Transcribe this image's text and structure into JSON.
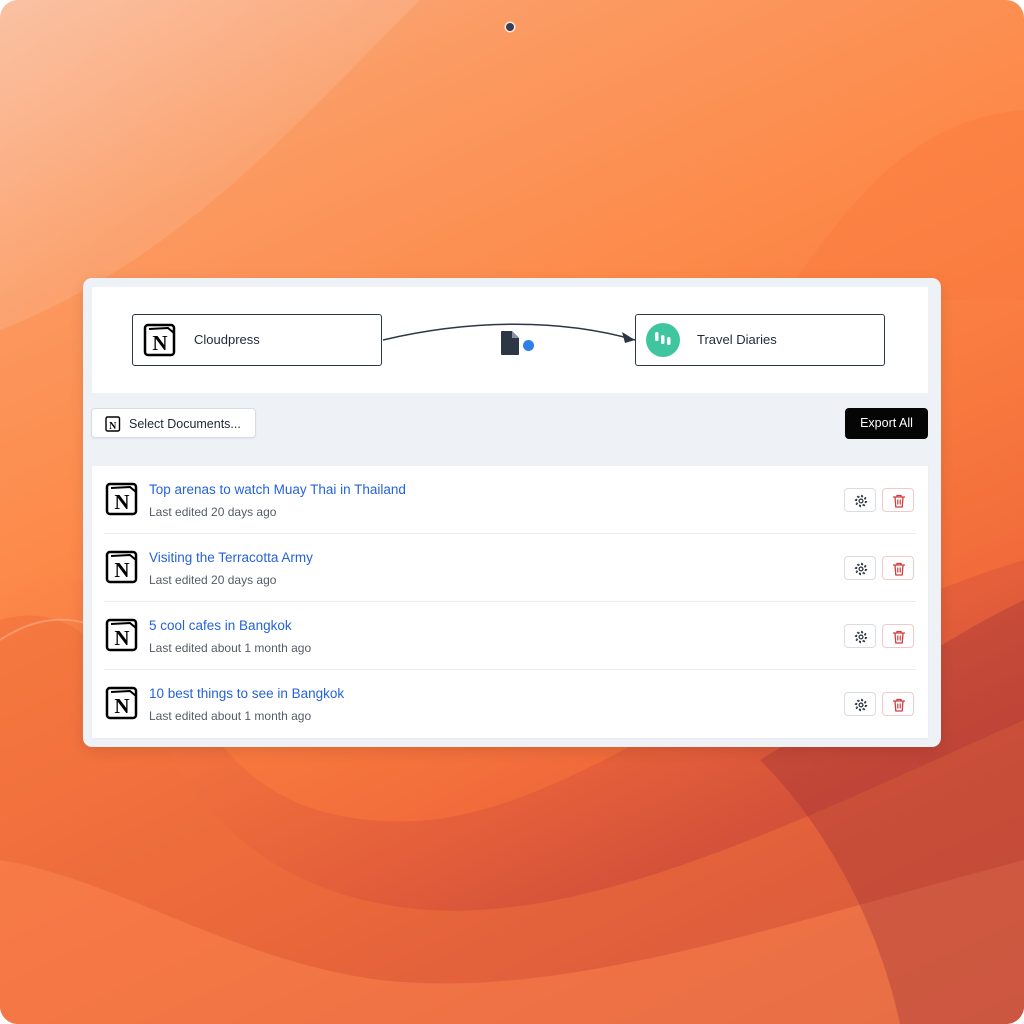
{
  "flow": {
    "source": {
      "label": "Cloudpress",
      "icon": "notion-icon"
    },
    "destination": {
      "label": "Travel Diaries",
      "icon": "ghost-icon",
      "color": "#3fc6a0"
    },
    "connector_icon": "document-icon",
    "status_color": "#2f7fe8"
  },
  "toolbar": {
    "select_label": "Select Documents...",
    "export_label": "Export All"
  },
  "documents": [
    {
      "title": "Top arenas to watch Muay Thai in Thailand",
      "meta": "Last edited 20 days ago"
    },
    {
      "title": "Visiting the Terracotta Army",
      "meta": "Last edited 20 days ago"
    },
    {
      "title": "5 cool cafes in Bangkok",
      "meta": "Last edited about 1 month ago"
    },
    {
      "title": "10 best things to see in Bangkok",
      "meta": "Last edited about 1 month ago"
    }
  ],
  "colors": {
    "link": "#2563d9",
    "danger": "#d23c3c",
    "export_button": "#050505"
  }
}
